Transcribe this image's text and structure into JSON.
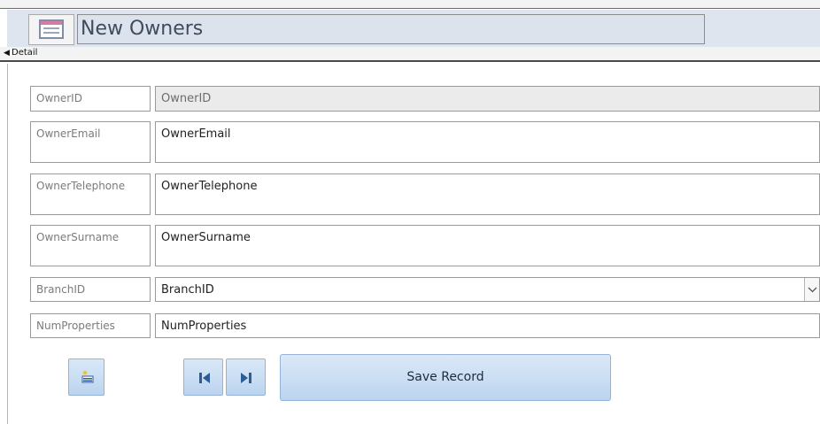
{
  "form": {
    "header_title": "New Owners",
    "detail_section_label": "Detail"
  },
  "fields": [
    {
      "label": "OwnerID",
      "value": "OwnerID",
      "readonly": true
    },
    {
      "label": "OwnerEmail",
      "value": "OwnerEmail",
      "readonly": false
    },
    {
      "label": "OwnerTelephone",
      "value": "OwnerTelephone",
      "readonly": false
    },
    {
      "label": "OwnerSurname",
      "value": "OwnerSurname",
      "readonly": false
    },
    {
      "label": "BranchID",
      "value": "BranchID",
      "readonly": false,
      "combo": true
    },
    {
      "label": "NumProperties",
      "value": "NumProperties",
      "readonly": false
    }
  ],
  "buttons": {
    "save_label": "Save Record",
    "new_record_icon": "new-record-icon",
    "first_icon": "go-to-first-icon",
    "last_icon": "go-to-last-icon"
  },
  "colors": {
    "header_bg": "#dfe5ee",
    "button_bg": "#c8dcf3",
    "button_border": "#93b3d9",
    "nav_icon": "#2e5d96"
  }
}
